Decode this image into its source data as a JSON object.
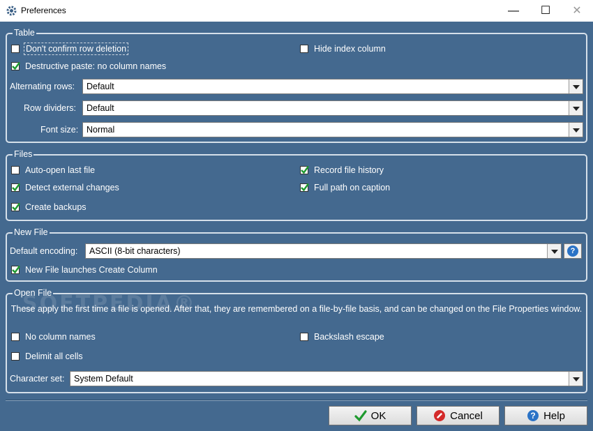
{
  "window": {
    "title": "Preferences",
    "controls": {
      "minimize": "—",
      "maximize": "☐",
      "close": "✕"
    }
  },
  "table": {
    "legend": "Table",
    "dont_confirm_row_deletion": {
      "label": "Don't confirm row deletion",
      "checked": false
    },
    "hide_index_column": {
      "label": "Hide index column",
      "checked": false
    },
    "destructive_paste": {
      "label": "Destructive paste: no column names",
      "checked": true
    },
    "alternating_rows": {
      "label": "Alternating rows:",
      "value": "Default"
    },
    "row_dividers": {
      "label": "Row dividers:",
      "value": "Default"
    },
    "font_size": {
      "label": "Font size:",
      "value": "Normal"
    }
  },
  "files": {
    "legend": "Files",
    "auto_open_last_file": {
      "label": "Auto-open last file",
      "checked": false
    },
    "record_file_history": {
      "label": "Record file history",
      "checked": true
    },
    "detect_external_changes": {
      "label": "Detect external changes",
      "checked": true
    },
    "full_path_on_caption": {
      "label": "Full path on caption",
      "checked": true
    },
    "create_backups": {
      "label": "Create backups",
      "checked": true
    }
  },
  "new_file": {
    "legend": "New File",
    "default_encoding": {
      "label": "Default encoding:",
      "value": "ASCII (8-bit characters)"
    },
    "help_glyph": "?",
    "launches_create_column": {
      "label": "New File launches Create Column",
      "checked": true
    }
  },
  "open_file": {
    "legend": "Open File",
    "description": "These apply the first time a file is opened.  After that, they are remembered on a file-by-file basis, and can be changed on the File Properties window.",
    "no_column_names": {
      "label": "No column names",
      "checked": false
    },
    "backslash_escape": {
      "label": "Backslash escape",
      "checked": false
    },
    "delimit_all_cells": {
      "label": "Delimit all cells",
      "checked": false
    },
    "character_set": {
      "label": "Character set:",
      "value": "System Default"
    }
  },
  "watermark": "SOFTPEDIA®",
  "buttons": {
    "ok": "OK",
    "cancel": "Cancel",
    "help": "Help"
  },
  "colors": {
    "panel": "#44698f",
    "border": "#d6e0ea",
    "check": "#1e9a2e",
    "help_blue": "#2b73c6",
    "cancel_red": "#d42a2a"
  }
}
